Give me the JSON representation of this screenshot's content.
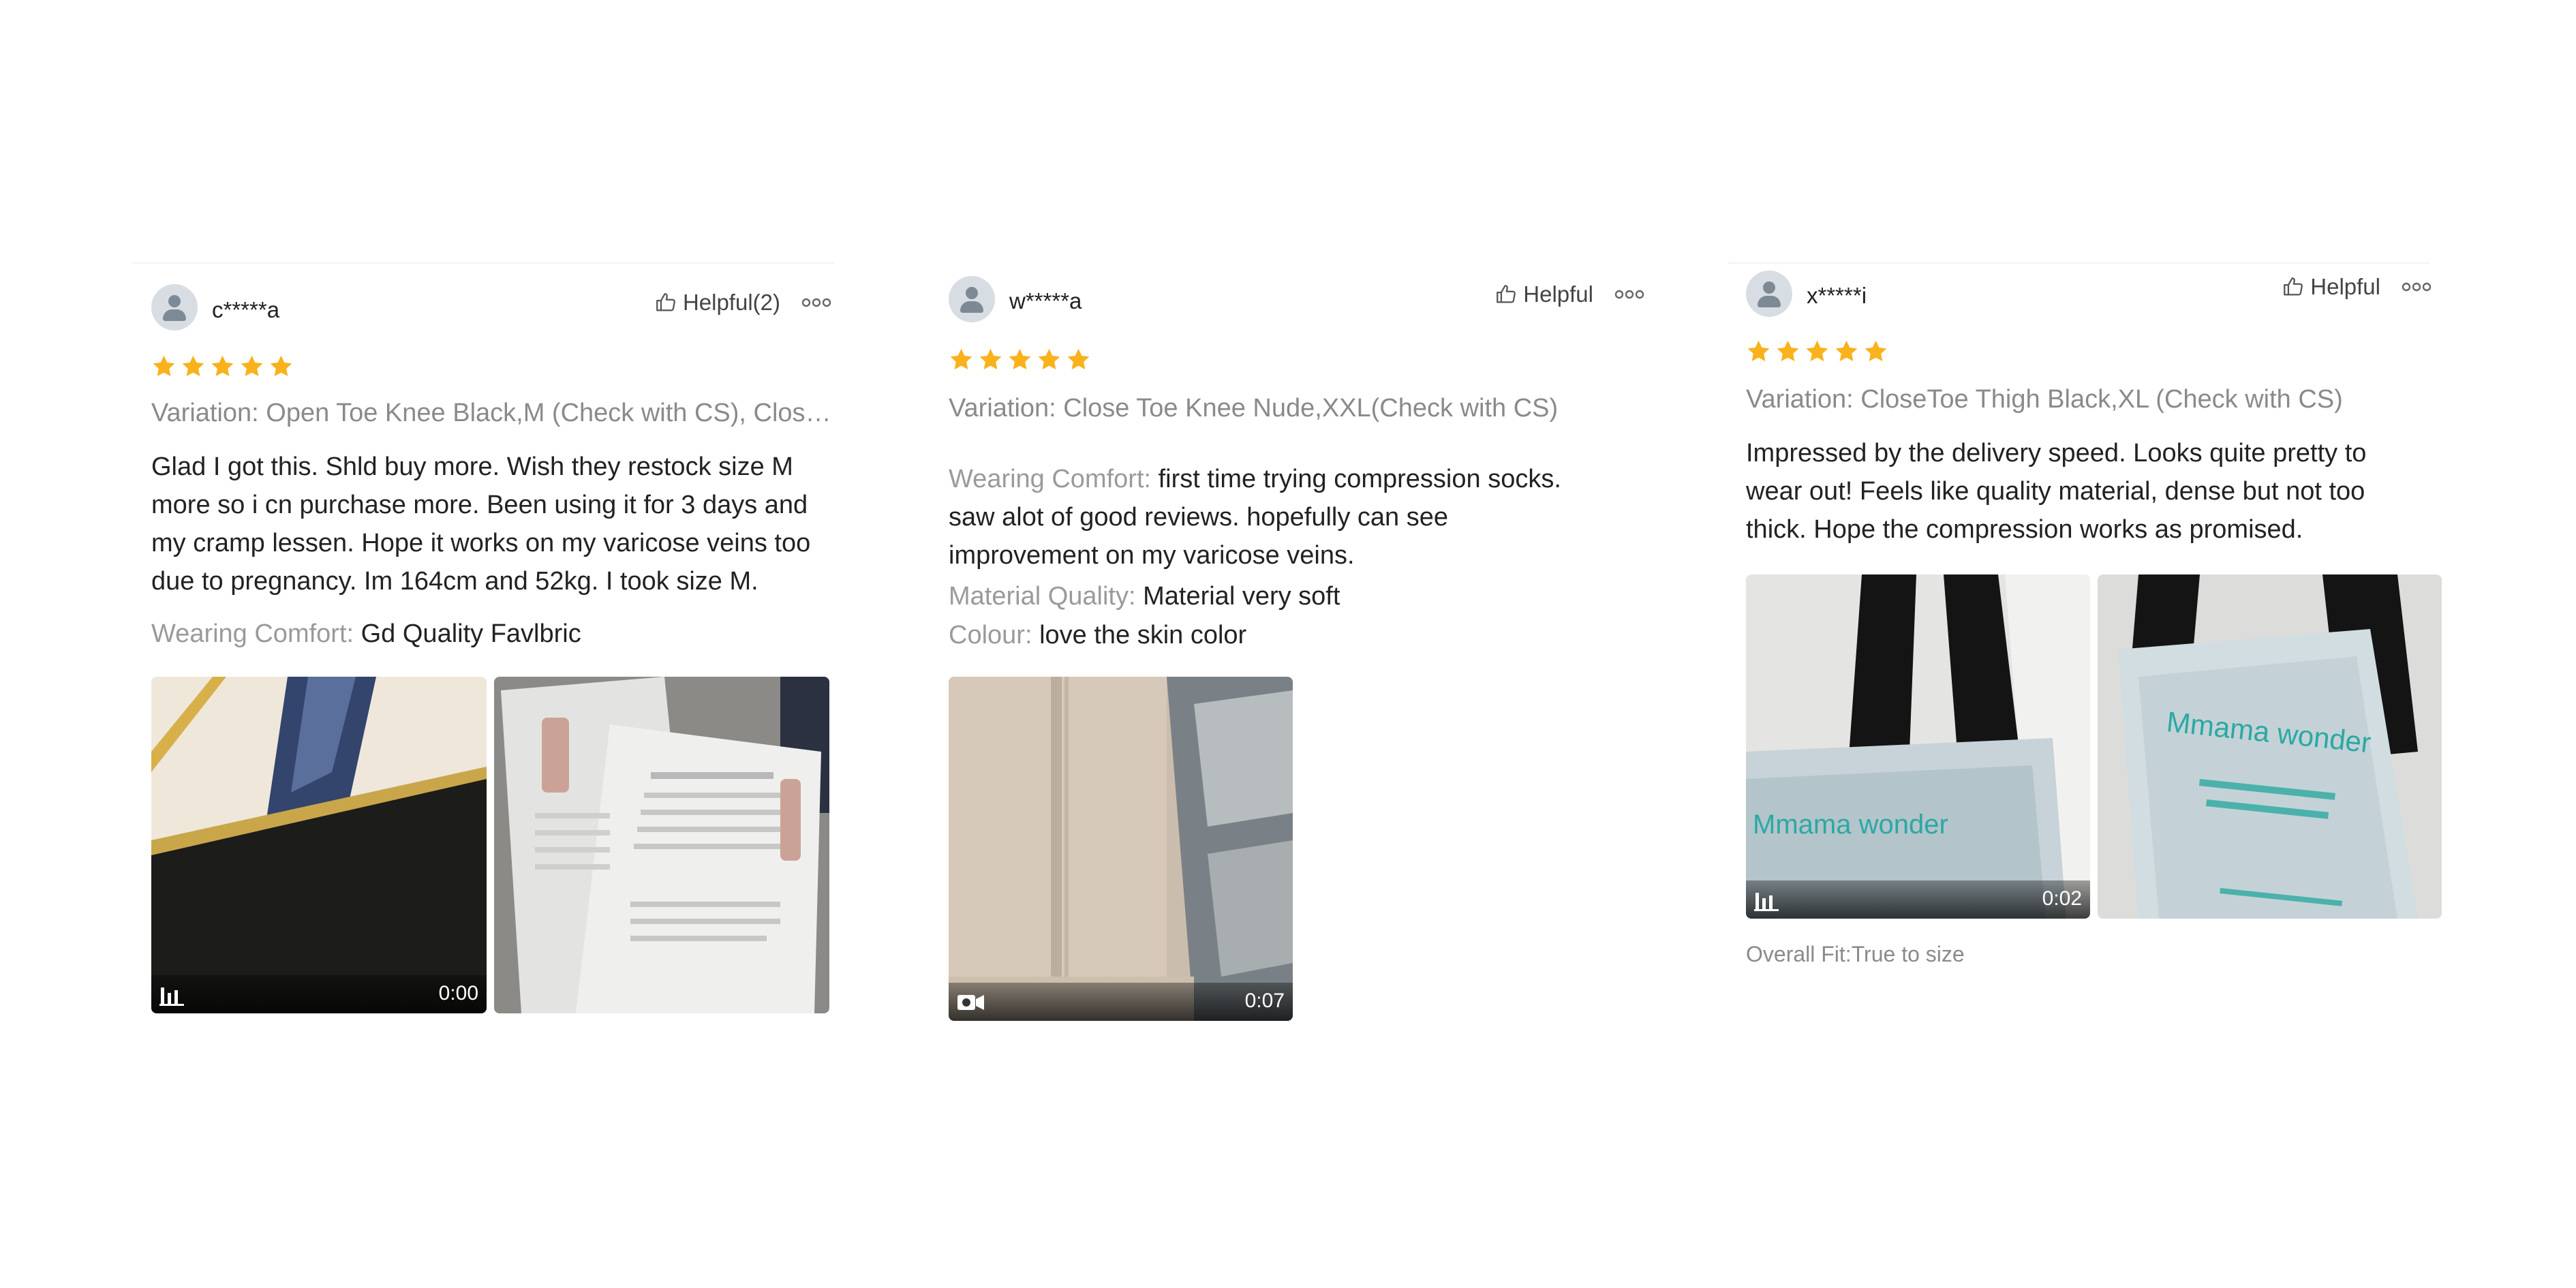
{
  "reviews": [
    {
      "username": "c*****a",
      "helpful_label": "Helpful(2)",
      "rating": 5,
      "variation": "Variation: Open Toe Knee Black,M (Check with CS), Close Toe Knee Nude,M(Check with CS)",
      "text": "Glad I got this. Shld buy more. Wish they restock size M more so i cn purchase more. Been using it for 3 days and my cramp lessen. Hope it works on my varicose veins too due to pregnancy. Im 164cm and 52kg. I took size M.",
      "attributes": [
        {
          "key": "Wearing Comfort:",
          "value": "Gd Quality Favlbric"
        }
      ],
      "media": [
        {
          "type": "video",
          "duration": "0:00",
          "icon": "audio-bars-icon"
        },
        {
          "type": "image"
        }
      ]
    },
    {
      "username": "w*****a",
      "helpful_label": "Helpful",
      "rating": 5,
      "variation": "Variation: Close Toe Knee Nude,XXL(Check with CS)",
      "attributes": [
        {
          "key": "Wearing Comfort:",
          "value": "first time trying compression socks. saw alot of good reviews. hopefully can see improvement on my varicose veins."
        },
        {
          "key": "Material Quality:",
          "value": "Material very soft"
        },
        {
          "key": "Colour:",
          "value": "love the skin color"
        }
      ],
      "media": [
        {
          "type": "video",
          "duration": "0:07",
          "icon": "video-camera-icon"
        }
      ]
    },
    {
      "username": "x*****i",
      "helpful_label": "Helpful",
      "rating": 5,
      "variation": "Variation: CloseToe Thigh Black,XL (Check with CS)",
      "text": "Impressed by the delivery speed. Looks quite pretty to wear out! Feels like quality material, dense but not too thick. Hope the compression works as promised.",
      "media": [
        {
          "type": "video",
          "duration": "0:02",
          "icon": "audio-bars-icon"
        },
        {
          "type": "image"
        }
      ],
      "overall_fit": "Overall Fit:True to size"
    }
  ],
  "colors": {
    "star": "#F9B21B",
    "muted_text": "#8A8A8A",
    "avatar_bg": "#D7DDE2"
  }
}
